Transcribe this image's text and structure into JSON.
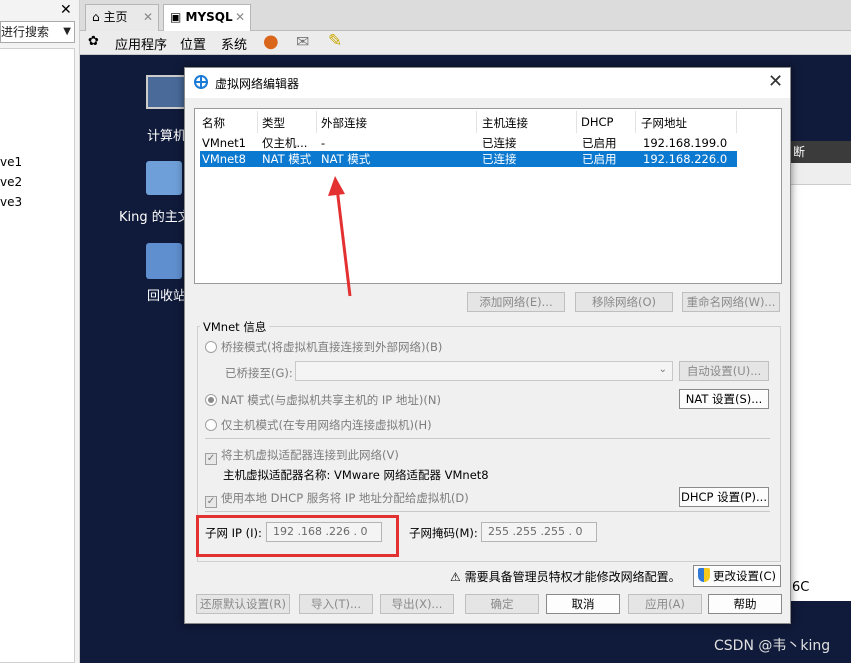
{
  "left_panel": {
    "close": "✕",
    "search_text": "进行搜索",
    "items": [
      "ve1",
      "ve2",
      "ve3"
    ]
  },
  "tabs": [
    {
      "label": "主页",
      "close": "✕"
    },
    {
      "label": "MYSQL",
      "close": "✕"
    }
  ],
  "menubar": {
    "items": [
      "应用程序",
      "位置",
      "系统"
    ]
  },
  "desktop": {
    "icons": [
      "计算机",
      "King 的主文",
      "回收站"
    ],
    "right_header": "断",
    "right_text": "6C",
    "watermark": "CSDN @韦丶king"
  },
  "dialog": {
    "title": "虚拟网络编辑器",
    "close": "✕",
    "table": {
      "headers": [
        "名称",
        "类型",
        "外部连接",
        "主机连接",
        "DHCP",
        "子网地址"
      ],
      "rows": [
        [
          "VMnet1",
          "仅主机...",
          "-",
          "已连接",
          "已启用",
          "192.168.199.0"
        ],
        [
          "VMnet8",
          "NAT 模式",
          "NAT 模式",
          "已连接",
          "已启用",
          "192.168.226.0"
        ]
      ],
      "selected_row": 1
    },
    "table_buttons": [
      "添加网络(E)...",
      "移除网络(O)",
      "重命名网络(W)..."
    ],
    "vmnet_info": {
      "title": "VMnet 信息",
      "bridge_mode": "桥接模式(将虚拟机直接连接到外部网络)(B)",
      "bridge_to_label": "已桥接至(G):",
      "auto_settings": "自动设置(U)...",
      "nat_mode": "NAT 模式(与虚拟机共享主机的 IP 地址)(N)",
      "nat_settings": "NAT 设置(S)...",
      "host_only": "仅主机模式(在专用网络内连接虚拟机)(H)",
      "connect_adapter": "将主机虚拟适配器连接到此网络(V)",
      "adapter_name": "主机虚拟适配器名称: VMware 网络适配器 VMnet8",
      "use_dhcp": "使用本地 DHCP 服务将 IP 地址分配给虚拟机(D)",
      "dhcp_settings": "DHCP 设置(P)...",
      "subnet_ip_label": "子网 IP (I):",
      "subnet_ip": "192 .168 .226 . 0",
      "subnet_mask_label": "子网掩码(M):",
      "subnet_mask": "255 .255 .255 . 0",
      "mode": "NAT"
    },
    "admin_warning": "需要具备管理员特权才能修改网络配置。",
    "change_settings": "更改设置(C)",
    "bottom_buttons": {
      "restore": "还原默认设置(R)",
      "import": "导入(T)...",
      "export": "导出(X)...",
      "ok": "确定",
      "cancel": "取消",
      "apply": "应用(A)",
      "help": "帮助"
    }
  },
  "colors": {
    "selection": "#0b79d0",
    "annotation_red": "#e33131",
    "desktop_bg": "#101a3a"
  }
}
